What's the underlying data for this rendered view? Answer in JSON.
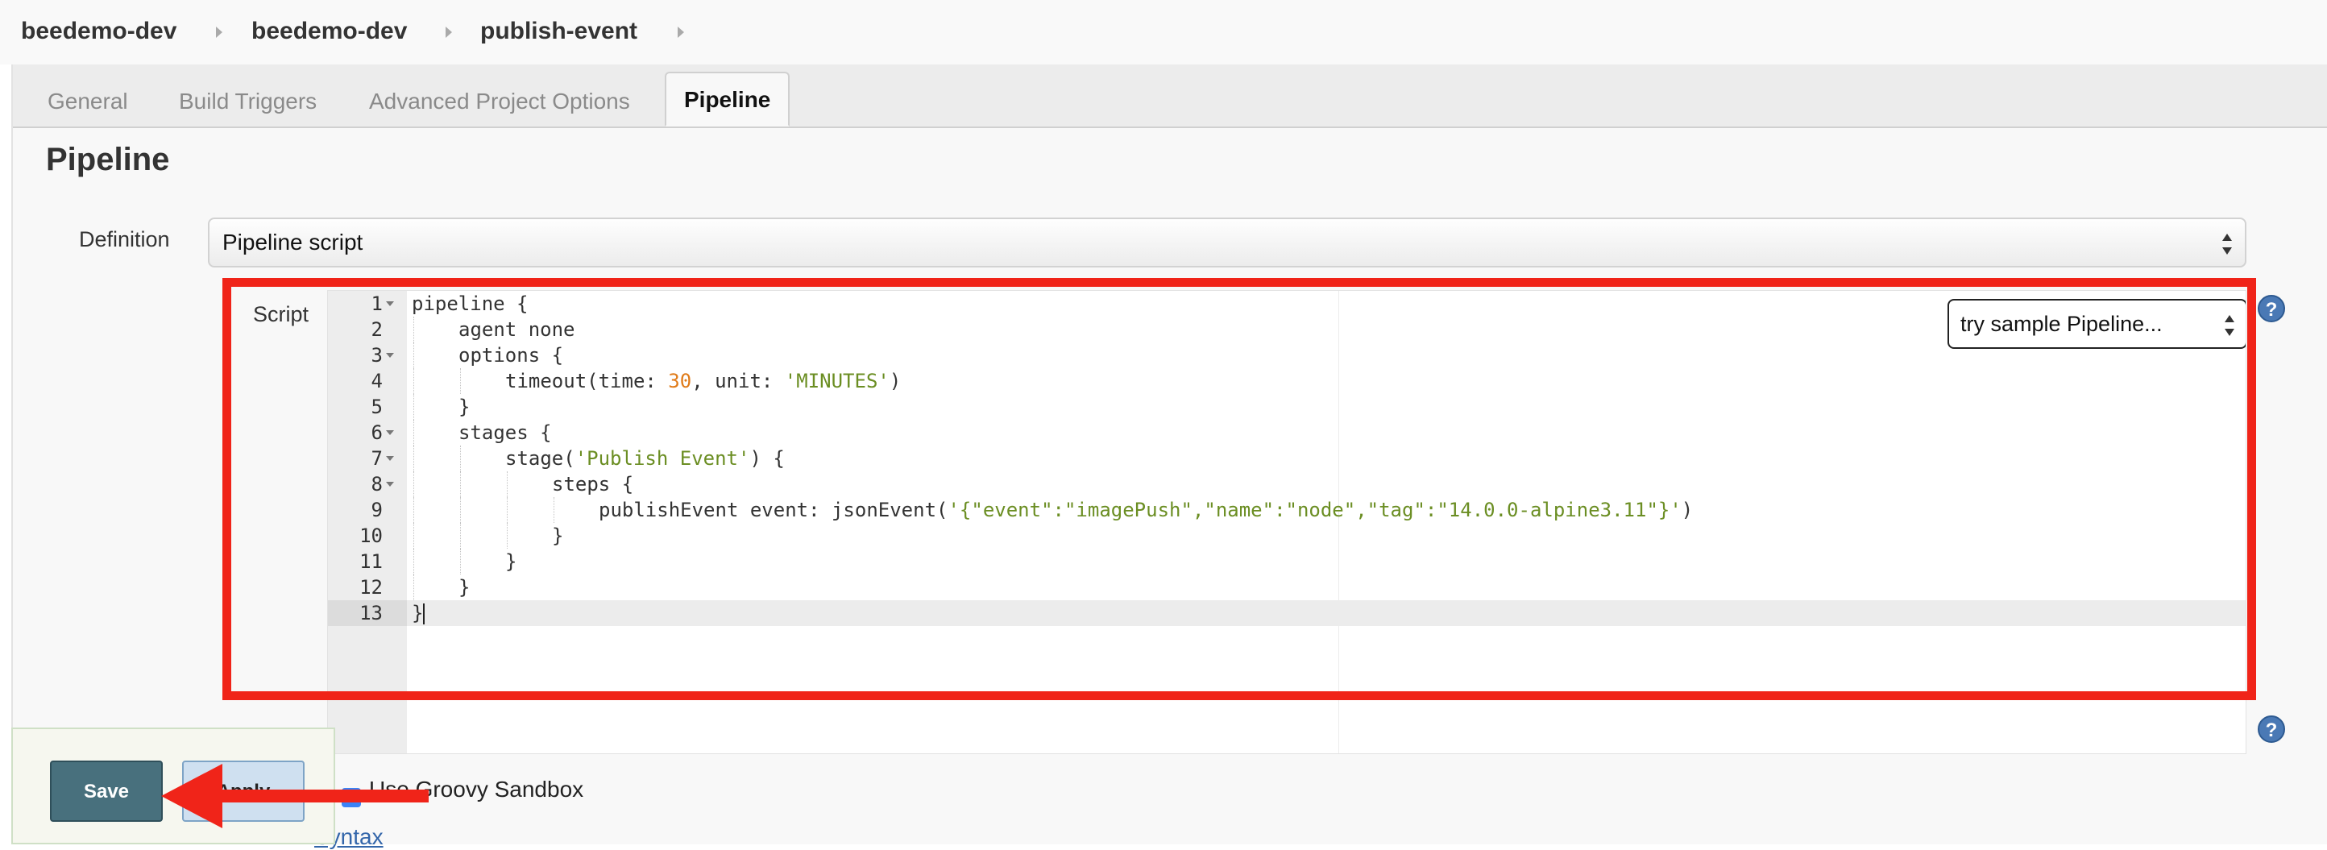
{
  "breadcrumb": {
    "items": [
      "beedemo-dev",
      "beedemo-dev",
      "publish-event"
    ]
  },
  "tabs": [
    {
      "label": "General",
      "active": false
    },
    {
      "label": "Build Triggers",
      "active": false
    },
    {
      "label": "Advanced Project Options",
      "active": false
    },
    {
      "label": "Pipeline",
      "active": true
    }
  ],
  "section": {
    "title": "Pipeline"
  },
  "definition": {
    "label": "Definition",
    "selected": "Pipeline script"
  },
  "script": {
    "label": "Script",
    "sample_select": "try sample Pipeline...",
    "lines": [
      {
        "n": "1",
        "text": "pipeline {"
      },
      {
        "n": "2",
        "text": "agent none"
      },
      {
        "n": "3",
        "text": "options {"
      },
      {
        "n": "4",
        "text": "timeout(time: 30, unit: 'MINUTES')"
      },
      {
        "n": "5",
        "text": "}"
      },
      {
        "n": "6",
        "text": "stages {"
      },
      {
        "n": "7",
        "text": "stage('Publish Event') {"
      },
      {
        "n": "8",
        "text": "steps {"
      },
      {
        "n": "9",
        "text": "publishEvent event: jsonEvent('{\"event\":\"imagePush\",\"name\":\"node\",\"tag\":\"14.0.0-alpine3.11\"}')"
      },
      {
        "n": "10",
        "text": "}"
      },
      {
        "n": "11",
        "text": "}"
      },
      {
        "n": "12",
        "text": "}"
      },
      {
        "n": "13",
        "text": "}"
      }
    ]
  },
  "sandbox": {
    "label": "Use Groovy Sandbox",
    "checked": true
  },
  "syntax_link": "Syntax",
  "buttons": {
    "save": "Save",
    "apply": "Apply"
  },
  "help_icon": "?",
  "colors": {
    "accent": "#4a79b5",
    "annotation": "#f02419",
    "save": "#48707d"
  }
}
